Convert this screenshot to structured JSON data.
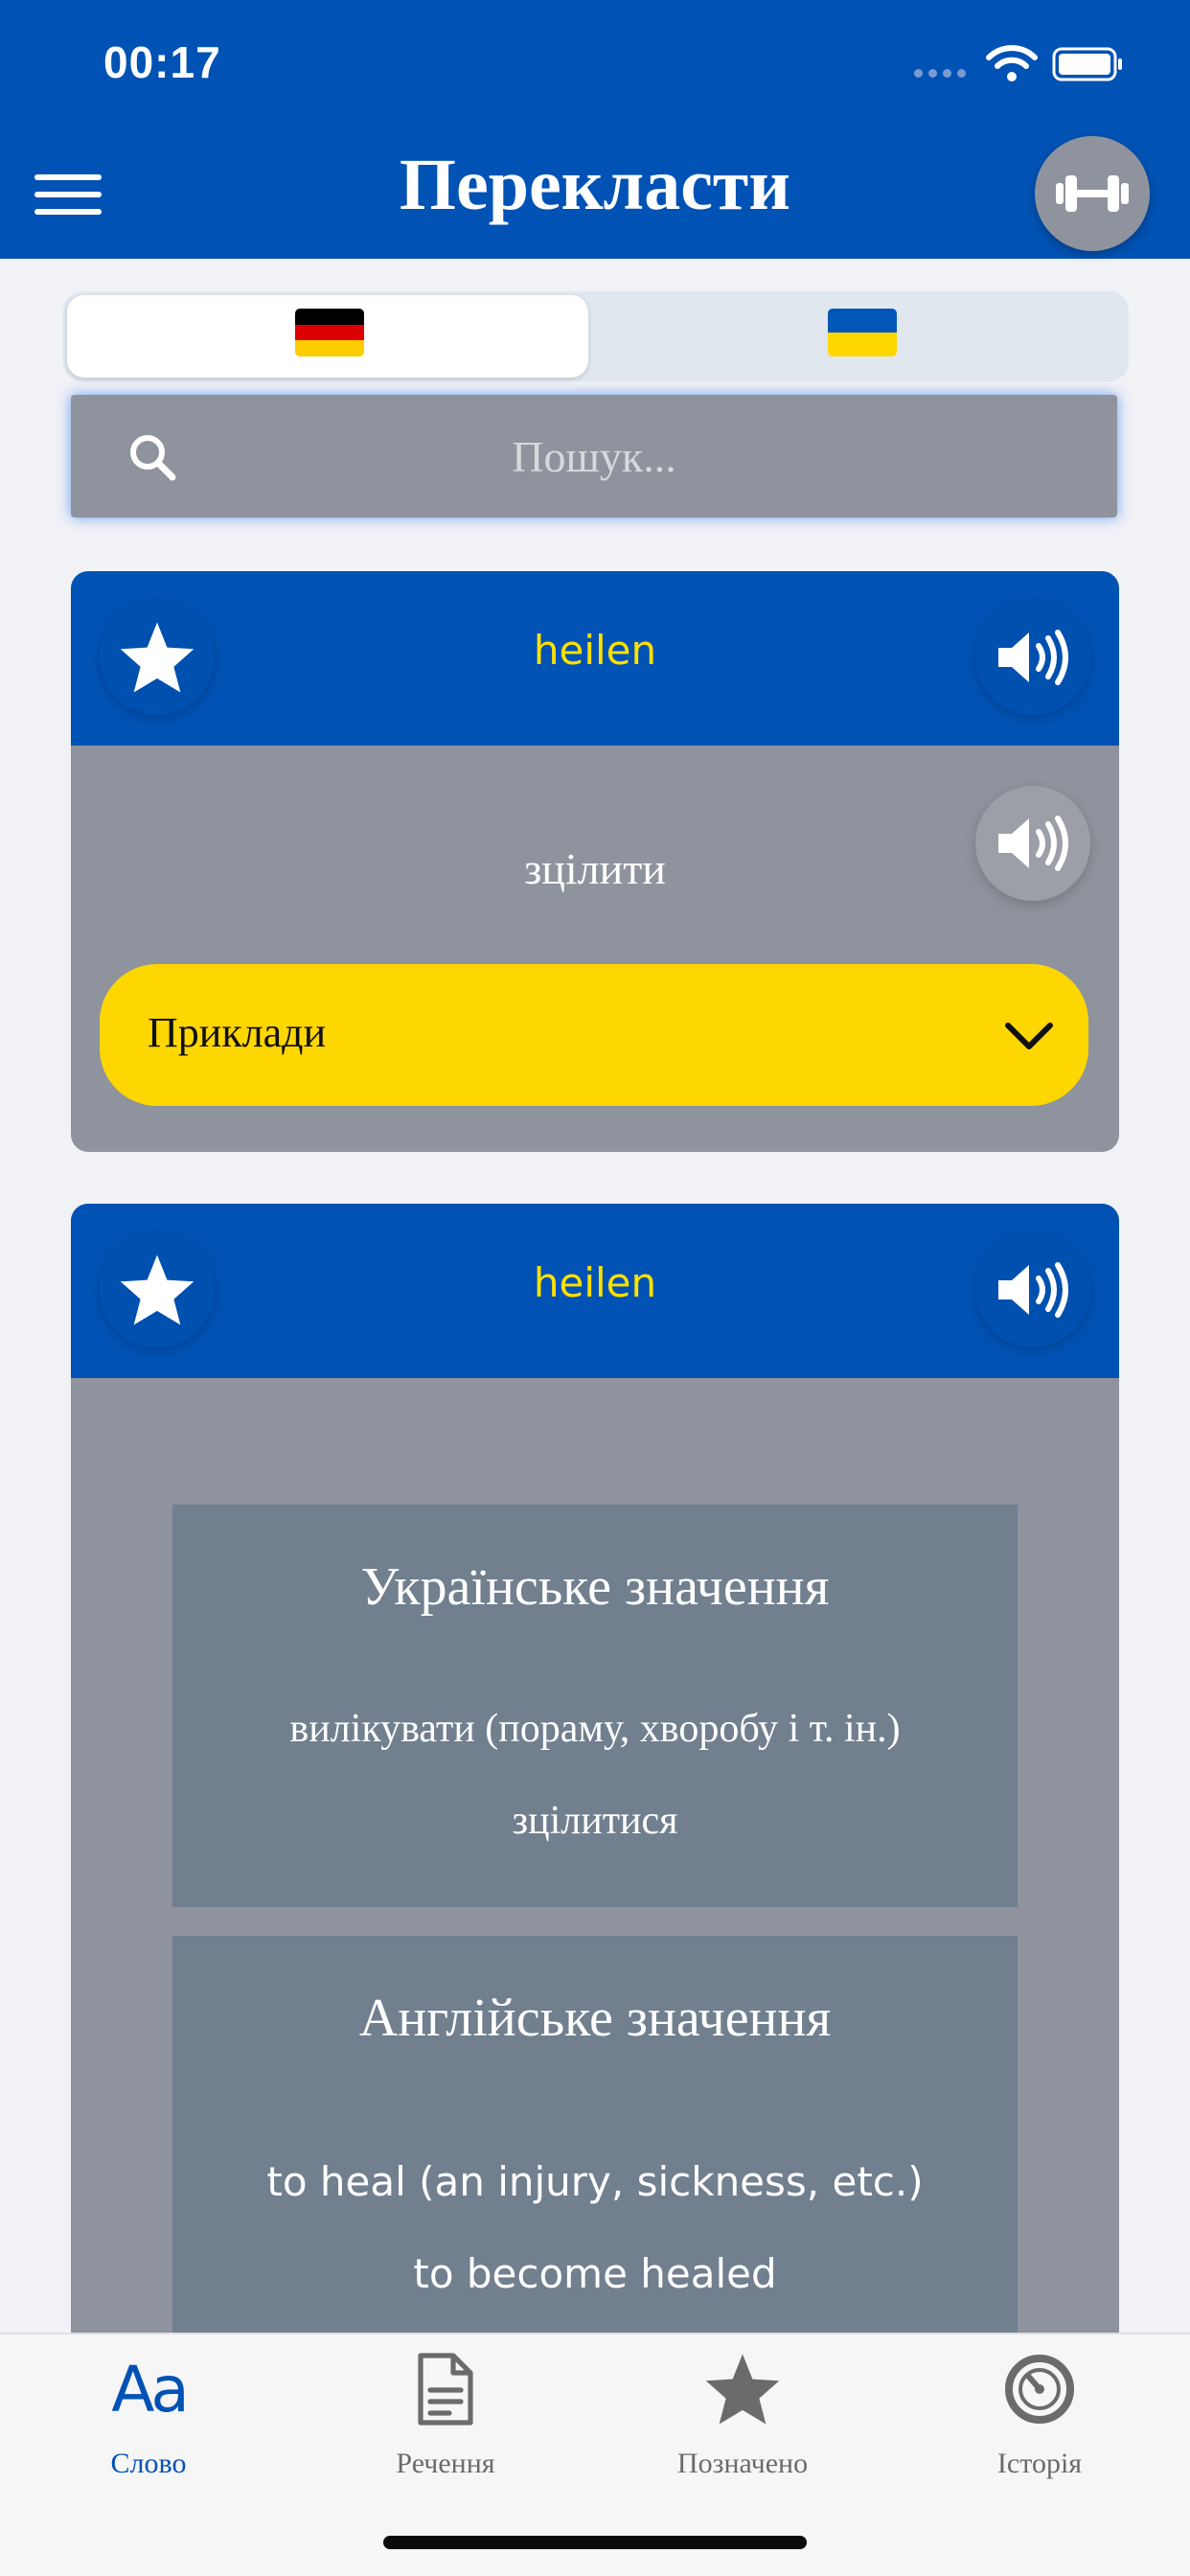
{
  "status_bar": {
    "time": "00:17"
  },
  "header": {
    "title": "Перекласти"
  },
  "search": {
    "placeholder": "Пошук..."
  },
  "language_toggle": {
    "options": [
      {
        "flag": "Germany",
        "selected": true
      },
      {
        "flag": "Ukraine",
        "selected": false
      }
    ]
  },
  "cards": [
    {
      "word": "heilen",
      "translation": "зцілити",
      "examples_label": "Приклади"
    },
    {
      "word": "heilen",
      "ukrainian_title": "Українське значення",
      "ukrainian_lines": [
        "вилікувати (пораму, хворобу і т. ін.)",
        "зцілитися"
      ],
      "english_title": "Англійське значення",
      "english_lines": [
        "to heal (an injury, sickness, etc.)",
        "to become healed"
      ]
    }
  ],
  "tabbar": {
    "tabs": [
      {
        "label": "Слово",
        "icon": "aa-icon",
        "active": true
      },
      {
        "label": "Речення",
        "icon": "document-icon",
        "active": false
      },
      {
        "label": "Позначено",
        "icon": "star-icon",
        "active": false
      },
      {
        "label": "Історія",
        "icon": "history-icon",
        "active": false
      }
    ]
  },
  "colors": {
    "brand_blue": "#0052B4",
    "accent_yellow": "#FFD700",
    "card_grey": "#8F939D",
    "meaning_box": "#717F8F"
  }
}
